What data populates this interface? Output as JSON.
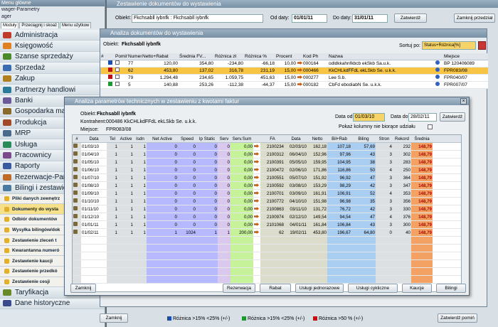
{
  "menu": {
    "title": "Menu główne",
    "lines": [
      "wager-Parametry",
      "ager"
    ],
    "tabs": [
      "Moduły",
      "Przeciągnij i skoaż",
      "Menu użytkow"
    ],
    "items": [
      {
        "label": "Administracja",
        "color": "#c03a2b"
      },
      {
        "label": "Księgowość",
        "color": "#e08020"
      },
      {
        "label": "Szanse sprzedaży",
        "color": "#4a8a2a"
      },
      {
        "label": "Sprzedaż",
        "color": "#3a6ab0"
      },
      {
        "label": "Zakup",
        "color": "#b08020"
      },
      {
        "label": "Partnerzy handlowi",
        "color": "#2a7a9a"
      },
      {
        "label": "Banki",
        "color": "#6a5a9a"
      },
      {
        "label": "Gospodarka mate",
        "color": "#8a6a2a"
      },
      {
        "label": "Produkcja",
        "color": "#a04a2a"
      },
      {
        "label": "MRP",
        "color": "#4a6a8a"
      },
      {
        "label": "Usługa",
        "color": "#2a8a5a"
      },
      {
        "label": "Pracownicy",
        "color": "#7a4a8a"
      },
      {
        "label": "Raporty",
        "color": "#3a5aa0"
      },
      {
        "label": "Rezerwacje-Paran",
        "color": "#c06a2a"
      },
      {
        "label": "Bilingi i zestawien",
        "color": "#4a7aa0"
      }
    ],
    "subitems": [
      {
        "label": "Pliki danych zewnętrz",
        "active": false
      },
      {
        "label": "Dokumenty do wysta",
        "active": true
      },
      {
        "label": "Odbiór dokumentów",
        "active": false
      },
      {
        "label": "Wysyłka bilingów/dok",
        "active": false
      },
      {
        "label": "Zestawienie zleceń t",
        "active": false
      },
      {
        "label": "Kwarantanna numeró",
        "active": false
      },
      {
        "label": "Zestawienie kaucji",
        "active": false
      },
      {
        "label": "Zestawienie przedkó",
        "active": false
      },
      {
        "label": "Zestawienie cesji",
        "active": false
      }
    ],
    "bottom": [
      {
        "label": "Taryfikacja",
        "color": "#6a8a2a"
      },
      {
        "label": "Dane historyczne",
        "color": "#3a4a8a"
      }
    ]
  },
  "main": {
    "title": "Zestawienie dokumentów do wystawienia",
    "obiekt_label": "Obiekt:",
    "obiekt_value": "Fkchsabll iybnfk : Fkchsabll iybnfk",
    "od_label": "Od daty:",
    "od_value": "01/01/11",
    "do_label": "Do daty:",
    "do_value": "31/01/11",
    "refresh": "Zatwierdź",
    "period_btn": "Zamknij przedział",
    "close_btn": "Zamknij",
    "legend": [
      "Różnica >15% <25% (+/-)",
      "Różnica >15% <25% (+/-)",
      "Różnica >50 % (+/-)"
    ],
    "confirm_btn": "Zatwierdź pomiń"
  },
  "analysis": {
    "title": "Analiza dokumentów do wystawienia",
    "obiekt_label": "Obiekt:",
    "obiekt_value": "Fkchsabll iybnfk",
    "sort_label": "Sortuj po:",
    "sort_value": "Status+Różnica[%]",
    "headers": [
      "#",
      "",
      "Pomiń",
      "Numer",
      "Netto+Rabat",
      "Średnia FV...",
      "Różnica zł",
      "Różnica %",
      "Procent",
      "",
      "Kod Ph",
      "Nazwa",
      "",
      "Miejsce"
    ],
    "rows": [
      {
        "flag": "#1a4fb0",
        "checked": false,
        "numer": "77",
        "netto": "120,00",
        "srednia": "354,80",
        "rz": "-234,80",
        "rp": "-66,18",
        "proc": "10,00",
        "kod": "000164",
        "nazwa": "odldkkahnfkbcb ekSkb Sa.u.k.",
        "miejsce": "BP 120406089",
        "sel": false
      },
      {
        "flag": "#c01010",
        "checked": false,
        "numer": "62",
        "netto": "453,80",
        "srednia": "137,02",
        "rz": "316,78",
        "rp": "231,19",
        "proc": "15,00",
        "kod": "000466",
        "nazwa": "KkCHLkdFFdL ekLSkb Se. u.k.k.",
        "miejsce": "FPR083/08",
        "sel": true
      },
      {
        "flag": "#c01010",
        "checked": false,
        "numer": "79",
        "netto": "1.294,48",
        "srednia": "234,65",
        "rz": "1.059,75",
        "rp": "451,63",
        "proc": "15,00",
        "kod": "000277",
        "nazwa": "Lee S.b.",
        "miejsce": "FPR040/07",
        "sel": false
      },
      {
        "flag": "#1a9a2a",
        "checked": false,
        "numer": "5",
        "netto": "140,88",
        "srednia": "253,26",
        "rz": "-112,38",
        "rp": "-44,37",
        "proc": "15,00",
        "kod": "000182",
        "nazwa": "CbFd ebodiabN Se. u.k.k.",
        "miejsce": "FPR007/07",
        "sel": false
      }
    ]
  },
  "dialog": {
    "title": "Analiza parametrów technicznych w zestawieniu z kwotami faktur",
    "obiekt_label": "Obiekt:",
    "obiekt_value": "Fkchsabll iybnfk",
    "kontr_label": "Kontrahent:",
    "kontr_value": "000486  KkCHLkdFFdL ekLSkb Se. u.k.k.",
    "miejsce_label": "Miejsce:",
    "miejsce_value": "FPR083/08",
    "from_label": "Data od:",
    "from_value": "01/03/10",
    "to_label": "Data do:",
    "to_value": "28/02/11",
    "refresh": "Zatwierdź",
    "hide_label": "Pokaż kolumny nie biorące udziału",
    "headers": [
      "#",
      "Data",
      "Tel",
      "Active",
      "Isdn",
      "Net Active",
      "Speed",
      "Ip Static",
      "Serv",
      "Serv.Sum",
      "",
      "FA",
      "Data",
      "Netto",
      "Bil+Rab",
      "Biling",
      "Stron",
      "Rekord",
      "Średnia"
    ],
    "rows": [
      [
        "01/03/10",
        "1",
        "1",
        "1",
        "0",
        "0",
        "0",
        "0",
        "0,00",
        "2100234",
        "02/03/10",
        "162,18",
        "107,18",
        "57,69",
        "4",
        "232",
        "148,79"
      ],
      [
        "01/04/10",
        "1",
        "1",
        "1",
        "0",
        "0",
        "0",
        "0",
        "0,00",
        "2100312",
        "06/04/10",
        "152,96",
        "97,96",
        "43",
        "3",
        "302",
        "148,79"
      ],
      [
        "01/05/10",
        "1",
        "1",
        "1",
        "0",
        "0",
        "0",
        "0",
        "0,00",
        "2100391",
        "05/05/10",
        "159,95",
        "104,95",
        "38",
        "3",
        "283",
        "148,79"
      ],
      [
        "01/06/10",
        "1",
        "1",
        "1",
        "0",
        "0",
        "0",
        "0",
        "0,00",
        "2100472",
        "02/06/10",
        "171,86",
        "116,86",
        "50",
        "4",
        "250",
        "148,79"
      ],
      [
        "01/07/10",
        "1",
        "1",
        "1",
        "0",
        "0",
        "0",
        "0",
        "0,00",
        "2100551",
        "05/07/10",
        "151,92",
        "96,92",
        "47",
        "3",
        "364",
        "148,79"
      ],
      [
        "01/08/10",
        "1",
        "1",
        "1",
        "0",
        "0",
        "0",
        "0",
        "0,00",
        "2100592",
        "03/08/10",
        "153,29",
        "98,29",
        "42",
        "3",
        "347",
        "148,79"
      ],
      [
        "01/09/10",
        "1",
        "1",
        "1",
        "0",
        "0",
        "0",
        "0",
        "0,00",
        "2100701",
        "03/09/10",
        "161,91",
        "106,91",
        "52",
        "4",
        "353",
        "148,79"
      ],
      [
        "01/10/10",
        "1",
        "1",
        "1",
        "0",
        "0",
        "0",
        "0",
        "0,00",
        "2100772",
        "04/10/10",
        "151,98",
        "96,98",
        "35",
        "3",
        "356",
        "148,79"
      ],
      [
        "01/11/10",
        "1",
        "1",
        "1",
        "0",
        "0",
        "0",
        "0",
        "0,00",
        "2100863",
        "03/11/10",
        "131,72",
        "76,72",
        "42",
        "3",
        "330",
        "148,79"
      ],
      [
        "01/12/10",
        "1",
        "1",
        "1",
        "0",
        "0",
        "0",
        "0",
        "0,00",
        "2100974",
        "02/12/10",
        "149,54",
        "94,54",
        "47",
        "4",
        "376",
        "148,79"
      ],
      [
        "01/01/11",
        "1",
        "1",
        "1",
        "0",
        "0",
        "0",
        "0",
        "0,00",
        "2101068",
        "04/01/11",
        "161,84",
        "106,84",
        "43",
        "3",
        "300",
        "148,79"
      ],
      [
        "01/02/11",
        "1",
        "1",
        "1",
        "1",
        "1024",
        "1",
        "1",
        "200,00",
        "62",
        "19/02/11",
        "453,80",
        "196,67",
        "64,80",
        "0",
        "40",
        "148,79"
      ]
    ],
    "buttons": {
      "close": "Zamknij",
      "rez": "Rezerwacja",
      "rabat": "Rabat",
      "jedn": "Usługi jednorazowe",
      "cykl": "Usługi cykliczne",
      "kaucje": "Kaucje",
      "bilingi": "Bilingi"
    }
  }
}
